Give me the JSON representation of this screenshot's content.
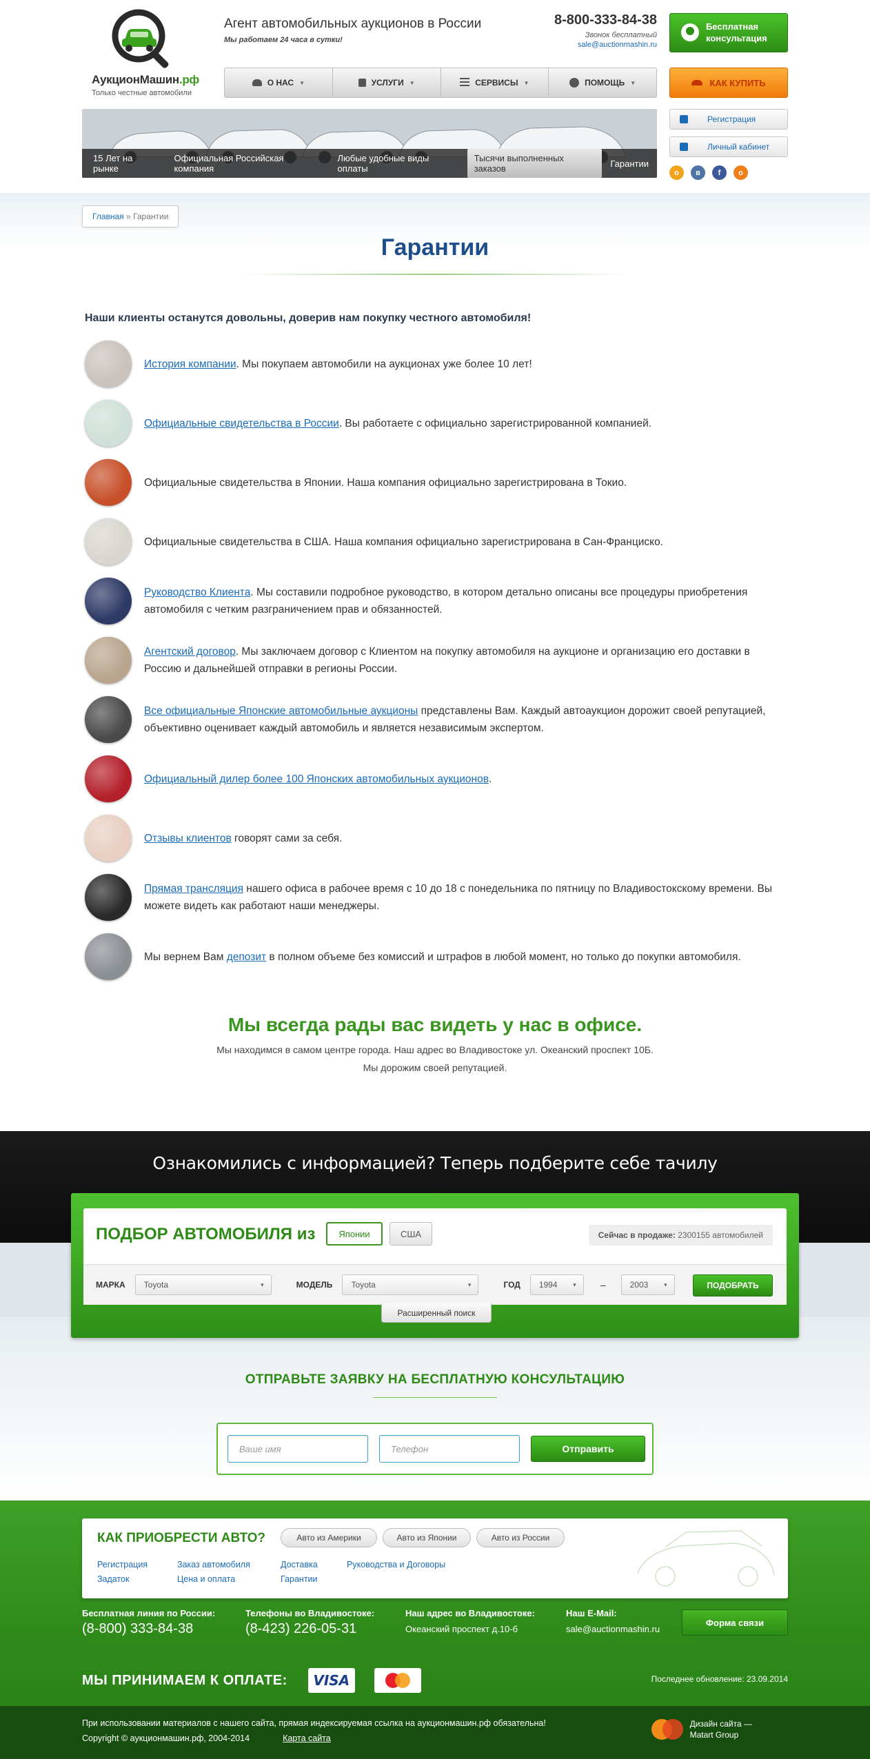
{
  "header": {
    "logo_name": "АукционМашин",
    "logo_tld": ".рф",
    "logo_sub": "Только честные автомобили",
    "tagline": "Агент автомобильных аукционов в России",
    "tagline_sub": "Мы работаем 24 часа в сутки!",
    "phone": "8-800-333-84-38",
    "phone_note": "Звонок бесплатный",
    "email": "sale@auctionmashin.ru",
    "consult_button": "Бесплатная консультация",
    "how_to_buy": "КАК КУПИТЬ",
    "register": "Регистрация",
    "cabinet": "Личный кабинет"
  },
  "nav": [
    {
      "label": "О НАС",
      "icon": "car-icon"
    },
    {
      "label": "УСЛУГИ",
      "icon": "lock-icon"
    },
    {
      "label": "СЕРВИСЫ",
      "icon": "list-icon"
    },
    {
      "label": "ПОМОЩЬ",
      "icon": "help-icon"
    }
  ],
  "banner_tabs": [
    "15 Лет на рынке",
    "Официальная Российская компания",
    "Любые удобные виды оплаты",
    "Тысячи выполненных заказов",
    "Гарантии"
  ],
  "socials": [
    {
      "name": "odnoklassniki-icon",
      "glyph": "о",
      "color": "#f2a31b"
    },
    {
      "name": "vk-icon",
      "glyph": "в",
      "color": "#4c75a3"
    },
    {
      "name": "facebook-icon",
      "glyph": "f",
      "color": "#3b5998"
    },
    {
      "name": "odnoklassniki-orange-icon",
      "glyph": "о",
      "color": "#ee7f1b"
    }
  ],
  "breadcrumb": {
    "home": "Главная",
    "sep": "»",
    "current": "Гарантии"
  },
  "page_title": "Гарантии",
  "intro": "Наши клиенты останутся довольны, доверив нам покупку честного автомобиля!",
  "guarantees": [
    {
      "link": "История компании",
      "text": ". Мы покупаем автомобили на аукционах уже более 10 лет!",
      "thumb": "#c9c2bd"
    },
    {
      "link": "Официальные свидетельства в России",
      "text": ". Вы работаете с официально зарегистрированной компанией.",
      "thumb": "#cfe0d8"
    },
    {
      "link": "",
      "text": "Официальные свидетельства в Японии. Наша компания официально зарегистрирована в Токио.",
      "thumb": "#c7502a"
    },
    {
      "link": "",
      "text": "Официальные свидетельства в США. Наша компания официально зарегистрирована в Сан-Франциско.",
      "thumb": "#d8d6cf"
    },
    {
      "link": "Руководство Клиента",
      "text": ". Мы составили подробное руководство, в котором детально описаны все процедуры приобретения автомобиля с четким разграничением прав и обязанностей.",
      "thumb": "#2e3a66"
    },
    {
      "link": "Агентский договор",
      "text": ". Мы заключаем договор с Клиентом на покупку автомобиля на аукционе и организацию его доставки в Россию и дальнейшей отправки в регионы России.",
      "thumb": "#b9a58d"
    },
    {
      "link": "Все официальные Японские автомобильные аукционы",
      "text": " представлены Вам. Каждый автоаукцион дорожит своей репутацией, объективно оценивает каждый автомобиль и является независимым экспертом.",
      "thumb": "#4a4a4a"
    },
    {
      "link": "Официальный дилер более 100 Японских автомобильных аукционов",
      "text": ".",
      "thumb": "#b4202a"
    },
    {
      "link": "Отзывы клиентов",
      "text": " говорят сами за себя.",
      "thumb": "#e8cfc1"
    },
    {
      "link": "Прямая трансляция",
      "text": " нашего офиса в рабочее время с 10 до 18 с понедельника по пятницу по Владивостокскому времени. Вы можете видеть как работают наши менеджеры.",
      "thumb": "#2a2a2a"
    },
    {
      "pre": "Мы вернем Вам ",
      "link": "депозит",
      "text": " в полном объеме без комиссий и штрафов в любой момент, но только до покупки автомобиля.",
      "thumb": "#8a8f94"
    }
  ],
  "office": {
    "title": "Мы всегда рады вас видеть у нас в офисе.",
    "line1": "Мы находимся в самом центре города. Наш адрес во Владивостоке ул. Океанский проспект 10Б.",
    "line2": "Мы дорожим своей репутацией."
  },
  "search": {
    "heading": "Ознакомились с информацией? Теперь подберите себе тачилу",
    "label": "ПОДБОР АВТОМОБИЛЯ из",
    "japan": "Японии",
    "usa": "США",
    "on_sale_label": "Сейчас в продаже:",
    "on_sale_value": "2300155 автомобилей",
    "make_label": "МАРКА",
    "make_value": "Toyota",
    "model_label": "МОДЕЛЬ",
    "model_value": "Toyota",
    "year_label": "ГОД",
    "year_from": "1994",
    "year_sep": "–",
    "year_to": "2003",
    "submit": "ПОДОБРАТЬ",
    "advanced": "Расширенный поиск"
  },
  "consult": {
    "title": "ОТПРАВЬТЕ ЗАЯВКУ НА БЕСПЛАТНУЮ КОНСУЛЬТАЦИЮ",
    "name_placeholder": "Ваше имя",
    "phone_placeholder": "Телефон",
    "submit": "Отправить"
  },
  "footer": {
    "question": "КАК ПРИОБРЕСТИ АВТО?",
    "origins": [
      "Авто из Америки",
      "Авто из Японии",
      "Авто из России"
    ],
    "links": [
      "Регистрация",
      "Заказ автомобиля",
      "Доставка",
      "Руководства и Договоры",
      "Задаток",
      "Цена и оплата",
      "Гарантии"
    ],
    "free_line_label": "Бесплатная линия по России:",
    "free_line": "(8-800) 333-84-38",
    "vl_phone_label": "Телефоны во Владивостоке:",
    "vl_phone": "(8-423) 226-05-31",
    "address_label": "Наш адрес во Владивостоке:",
    "address": "Океанский проспект д.10-б",
    "email_label": "Наш E-Mail:",
    "email": "sale@auctionmashin.ru",
    "contact_form": "Форма связи",
    "payment_label": "МЫ ПРИНИМАЕМ К ОПЛАТЕ:",
    "visa": "VISA",
    "updated": "Последнее обновление: 23.09.2014",
    "notice": "При использовании материалов с нашего сайта, прямая индексируемая ссылка на аукционмашин.рф обязательна!",
    "copyright": "Copyright © аукционмашин.рф, 2004-2014",
    "sitemap": "Карта сайта",
    "designer": "Дизайн сайта —",
    "designer_name": "Matart Group"
  }
}
